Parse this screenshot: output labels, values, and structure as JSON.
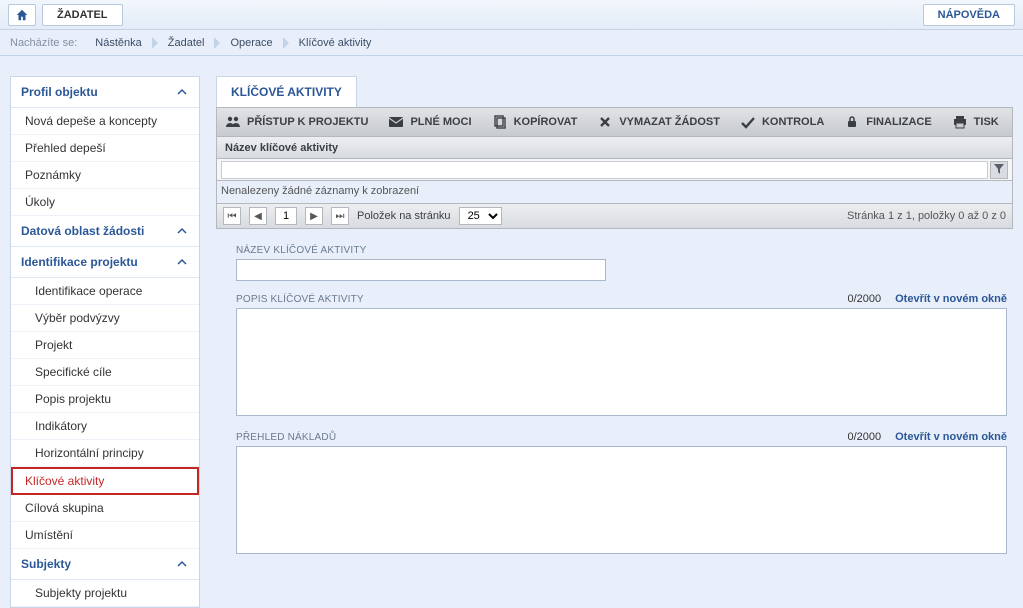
{
  "topbar": {
    "applicant_label": "ŽADATEL",
    "help_label": "NÁPOVĚDA"
  },
  "breadcrumb": {
    "label": "Nacházíte se:",
    "items": [
      "Nástěnka",
      "Žadatel",
      "Operace",
      "Klíčové aktivity"
    ]
  },
  "sidebar": {
    "sections": [
      {
        "title": "Profil objektu",
        "items": [
          "Nová depeše a koncepty",
          "Přehled depeší",
          "Poznámky",
          "Úkoly"
        ]
      },
      {
        "title": "Datová oblast žádosti",
        "items": []
      },
      {
        "title": "Identifikace projektu",
        "items": [
          "Identifikace operace",
          "Výběr podvýzvy",
          "Projekt",
          "Specifické cíle",
          "Popis projektu",
          "Indikátory",
          "Horizontální principy",
          "Klíčové aktivity",
          "Cílová skupina",
          "Umístění"
        ]
      },
      {
        "title": "Subjekty",
        "items": [
          "Subjekty projektu"
        ]
      }
    ],
    "active_item": "Klíčové aktivity"
  },
  "tab": {
    "title": "KLÍČOVÉ AKTIVITY"
  },
  "toolbar": {
    "items": [
      {
        "id": "access",
        "label": "PŘÍSTUP K PROJEKTU"
      },
      {
        "id": "poa",
        "label": "PLNÉ MOCI"
      },
      {
        "id": "copy",
        "label": "KOPÍROVAT"
      },
      {
        "id": "delete",
        "label": "VYMAZAT ŽÁDOST"
      },
      {
        "id": "check",
        "label": "KONTROLA"
      },
      {
        "id": "finalize",
        "label": "FINALIZACE"
      },
      {
        "id": "print",
        "label": "TISK"
      }
    ]
  },
  "grid": {
    "header": "Název klíčové aktivity",
    "filter_value": "",
    "empty_text": "Nenalezeny žádné záznamy k zobrazení",
    "pager": {
      "page": "1",
      "per_page_label": "Položek na stránku",
      "per_page_value": "25",
      "info": "Stránka 1 z 1, položky 0 až 0 z 0"
    }
  },
  "form": {
    "name_label": "NÁZEV KLÍČOVÉ AKTIVITY",
    "name_value": "",
    "desc_label": "POPIS KLÍČOVÉ AKTIVITY",
    "desc_counter": "0/2000",
    "desc_value": "",
    "costs_label": "PŘEHLED NÁKLADŮ",
    "costs_counter": "0/2000",
    "costs_value": "",
    "open_window": "Otevřít v novém okně"
  }
}
